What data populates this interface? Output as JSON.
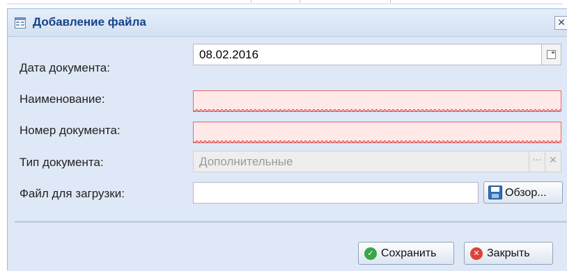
{
  "dialog": {
    "title": "Добавление файла",
    "close_symbol": "✕"
  },
  "fields": {
    "date": {
      "label": "Дата документа:",
      "value": "08.02.2016"
    },
    "name": {
      "label": "Наименование:",
      "value": "",
      "invalid": true
    },
    "number": {
      "label": "Номер документа:",
      "value": "",
      "invalid": true
    },
    "type": {
      "label": "Тип документа:",
      "value": "Дополнительные",
      "disabled": true,
      "trigger_more": "···",
      "trigger_clear": "✕"
    },
    "file": {
      "label": "Файл для загрузки:",
      "value": "",
      "browse_label": "Обзор..."
    }
  },
  "buttons": {
    "save": "Сохранить",
    "close": "Закрыть"
  },
  "icons": [
    "dialog-window-icon",
    "close-icon",
    "calendar-icon",
    "ellipsis-icon",
    "clear-icon",
    "floppy-disk-icon",
    "check-circle-icon",
    "cancel-circle-icon"
  ],
  "colors": {
    "window_bg": "#dfe8f6",
    "title_text": "#15428b",
    "invalid_bg": "#ffe8e8",
    "invalid_border": "#e06a6a",
    "save_icon": "#3aa64a",
    "close_icon": "#e0413a"
  }
}
